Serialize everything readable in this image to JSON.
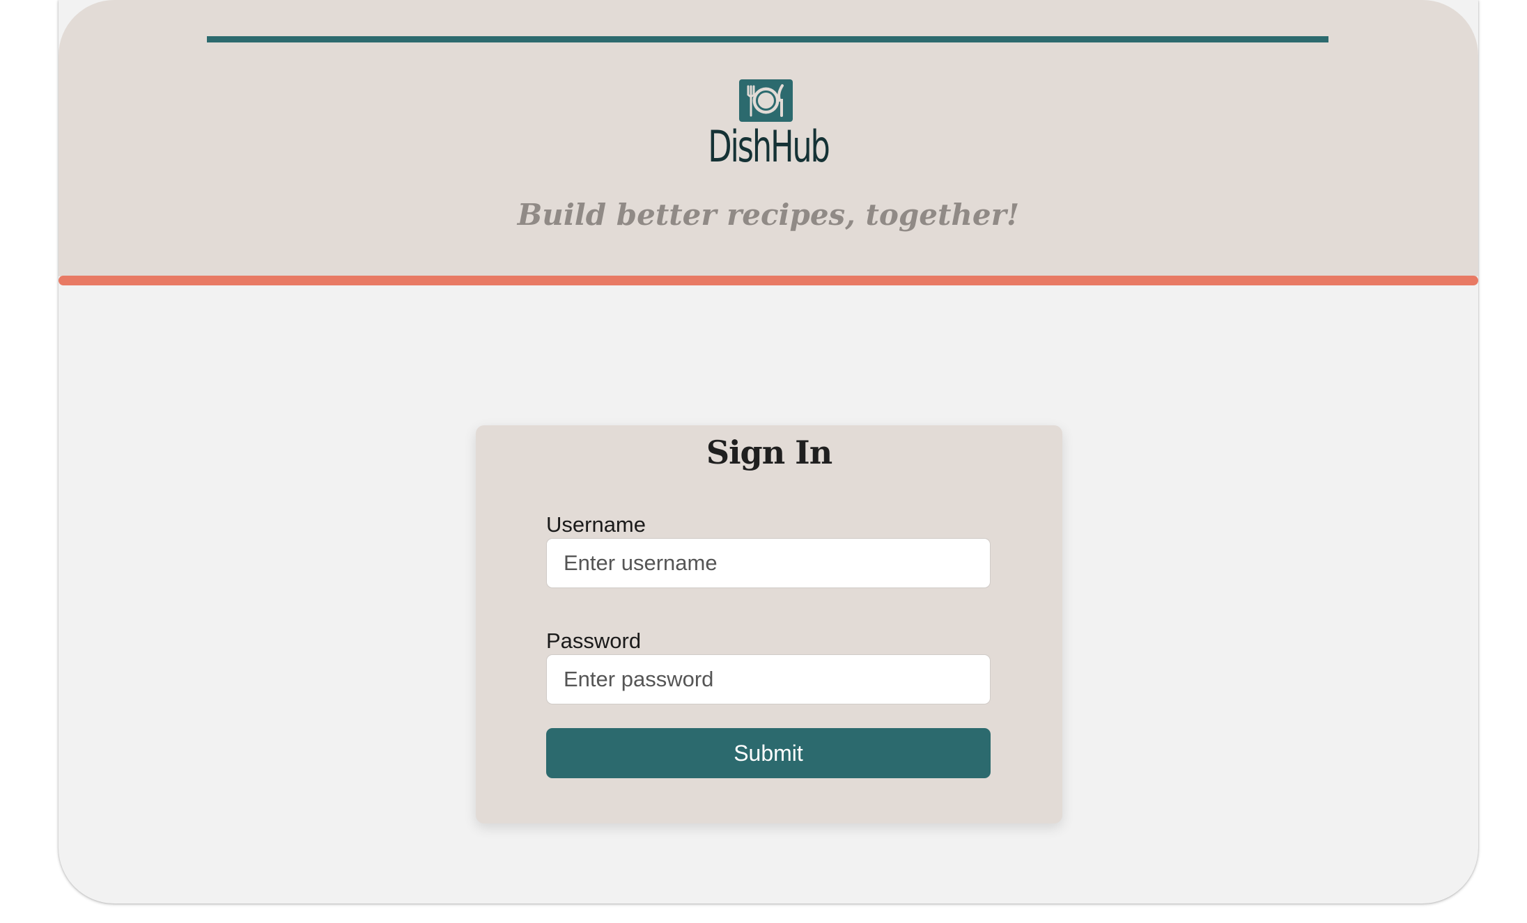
{
  "brand": {
    "name": "DishHub",
    "tagline": "Build better recipes, together!",
    "icon": "plate-fork-knife-icon"
  },
  "colors": {
    "teal": "#2c6a6e",
    "coral": "#e87a64",
    "header_bg": "#e2dbd6",
    "page_bg": "#f2f2f2"
  },
  "signin": {
    "title": "Sign In",
    "username_label": "Username",
    "username_placeholder": "Enter username",
    "username_value": "",
    "password_label": "Password",
    "password_placeholder": "Enter password",
    "password_value": "",
    "submit_label": "Submit"
  }
}
